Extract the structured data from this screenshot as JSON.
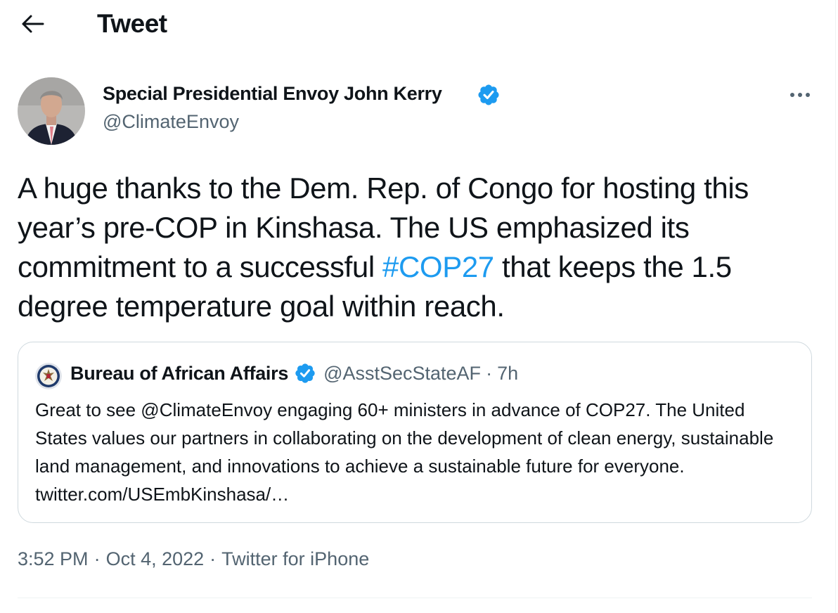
{
  "header": {
    "title": "Tweet",
    "back_icon": "arrow-left-icon"
  },
  "tweet": {
    "author_name": "Special Presidential Envoy John Kerry",
    "handle": "@ClimateEnvoy",
    "verified_icon": "verified-badge-icon",
    "more_icon": "more-horizontal-icon",
    "text_before": "A huge thanks to the Dem. Rep. of Congo for hosting this year’s pre-COP in Kinshasa. The US emphasized its commitment to a successful ",
    "hashtag": "#COP27",
    "text_after": " that keeps the 1.5 degree temperature goal within reach.",
    "time": "3:52 PM",
    "date": "Oct 4, 2022",
    "source": "Twitter for iPhone",
    "separator": "·"
  },
  "quote": {
    "name": "Bureau of African Affairs",
    "handle": "@AsstSecStateAF",
    "dot": "·",
    "time": "7h",
    "text": "Great to see @ClimateEnvoy engaging 60+ ministers in advance of COP27. The United States values our partners in collaborating on the development of clean energy, sustainable land management, and innovations to achieve a sustainable future for everyone. twitter.com/USEmbKinshasa/…"
  },
  "colors": {
    "link": "#1d9bf0",
    "text": "#0f1419",
    "secondary": "#536471",
    "border": "#cfd9de"
  }
}
